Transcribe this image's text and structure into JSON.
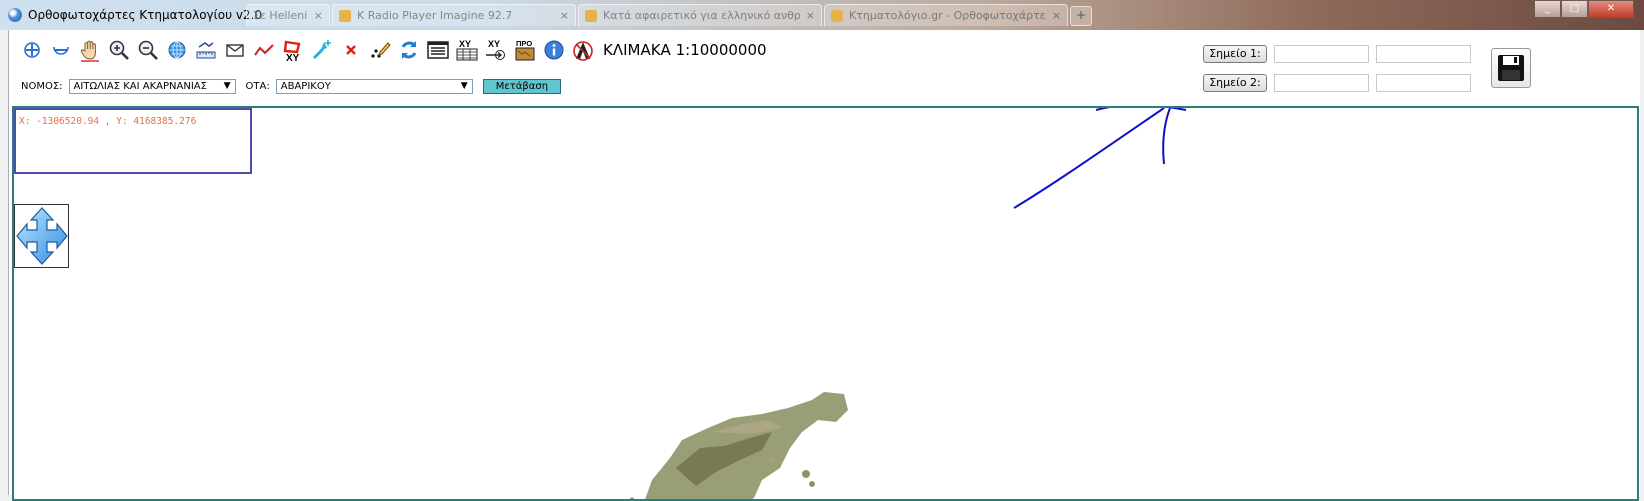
{
  "window": {
    "title": "Ορθοφωτοχάρτες Κτηματολογίου v2.0",
    "tabs": [
      {
        "label": "Σε Hellenic...",
        "close": "×"
      },
      {
        "label": "K Radio Player Imagine 92.7",
        "close": "×"
      },
      {
        "label": "Κατά αφαιρετικό για ελληνικό ανθρώ...",
        "close": "×"
      },
      {
        "label": "Κτηματολόγιο.gr - Ορθοφωτοχάρτες - NextWeb...",
        "close": "×"
      }
    ],
    "new_tab": "+",
    "controls": {
      "minimize": "_",
      "maximize": "□",
      "close": "✕"
    }
  },
  "toolbar": {
    "tools": [
      {
        "name": "zoom-in-small",
        "icon": "plus-circle-icon"
      },
      {
        "name": "zoom-out-small",
        "icon": "minus-circle-icon"
      },
      {
        "name": "pan",
        "icon": "hand-icon"
      },
      {
        "name": "zoom-in",
        "icon": "magnifier-plus-icon"
      },
      {
        "name": "zoom-out",
        "icon": "magnifier-minus-icon"
      },
      {
        "name": "full-extent",
        "icon": "globe-icon"
      },
      {
        "name": "measure",
        "icon": "ruler-icon"
      },
      {
        "name": "email",
        "icon": "envelope-icon"
      },
      {
        "name": "polyline",
        "icon": "polyline-icon"
      },
      {
        "name": "polygon-xy",
        "icon": "polygon-xy-icon"
      },
      {
        "name": "select-point",
        "icon": "star-point-icon"
      },
      {
        "name": "clear",
        "icon": "red-x-icon"
      },
      {
        "name": "edit-points",
        "icon": "pencil-points-icon"
      },
      {
        "name": "refresh",
        "icon": "refresh-icon"
      },
      {
        "name": "layers",
        "icon": "window-list-icon"
      },
      {
        "name": "xy-table",
        "icon": "xy-table-icon"
      },
      {
        "name": "xy-goto",
        "icon": "xy-arrow-icon"
      },
      {
        "name": "projection",
        "icon": "pro-map-icon"
      },
      {
        "name": "info",
        "icon": "info-icon"
      },
      {
        "name": "no-label",
        "icon": "no-a-icon"
      }
    ],
    "xy_label": "XY",
    "pro_label": "ΠΡΟ",
    "scale_label": "ΚΛΙΜΑΚΑ 1:10000000"
  },
  "filters": {
    "nomos_label": "ΝΟΜΟΣ:",
    "nomos_value": "ΑΙΤΩΛΙΑΣ ΚΑΙ ΑΚΑΡΝΑΝΙΑΣ",
    "ota_label": "ΟΤΑ:",
    "ota_value": "ΑΒΑΡΙΚΟΥ",
    "go_button": "Μετάβαση"
  },
  "points": {
    "point1_button": "Σημείο 1:",
    "point2_button": "Σημείο 2:",
    "point1_x": "",
    "point1_y": "",
    "point2_x": "",
    "point2_y": ""
  },
  "map": {
    "coordinates": "X: -1306520.94 , Y: 4168385.276"
  },
  "colors": {
    "map_border": "#2e7d7d",
    "coord_border": "#4b4bb0",
    "coord_text": "#e2714a",
    "go_button_bg": "#5fc5cf",
    "annotation": "#1010c8"
  }
}
